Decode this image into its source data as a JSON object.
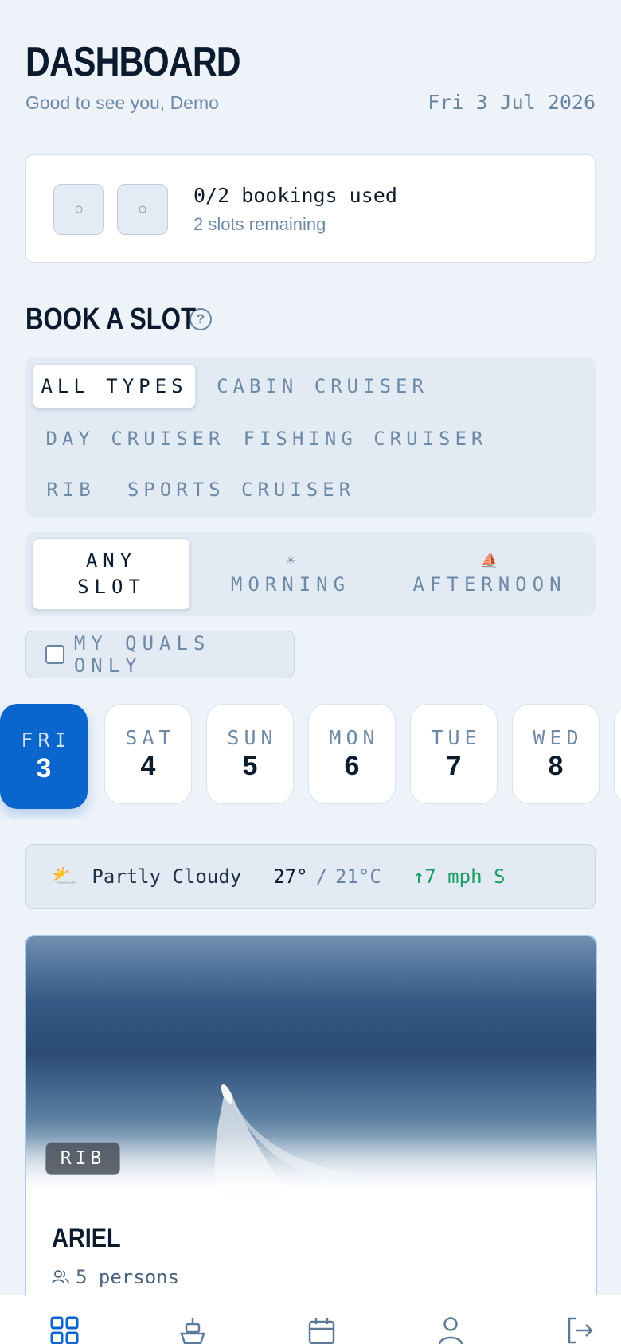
{
  "header": {
    "title": "DASHBOARD",
    "greeting": "Good to see you, Demo",
    "date": "Fri 3 Jul 2026"
  },
  "bookings": {
    "slot_marker": "○",
    "used_text": "0/2 bookings used",
    "remaining_text": "2 slots remaining"
  },
  "section": {
    "title": "BOOK A SLOT",
    "help_glyph": "?"
  },
  "boat_types": {
    "items": [
      "ALL TYPES",
      "CABIN CRUISER",
      "DAY CRUISER",
      "FISHING CRUISER",
      "RIB",
      "SPORTS CRUISER"
    ],
    "selected": "ALL TYPES"
  },
  "slots": {
    "any_line1": "ANY",
    "any_line2": "SLOT",
    "morning": "MORNING",
    "morning_icon": "☀",
    "afternoon": "AFTERNOON",
    "afternoon_icon": "⛵",
    "selected": "ANY SLOT"
  },
  "filters": {
    "quals_label": "MY QUALS ONLY",
    "quals_checked": false
  },
  "days": [
    {
      "name": "FRI",
      "num": "3",
      "selected": true
    },
    {
      "name": "SAT",
      "num": "4",
      "selected": false
    },
    {
      "name": "SUN",
      "num": "5",
      "selected": false
    },
    {
      "name": "MON",
      "num": "6",
      "selected": false
    },
    {
      "name": "TUE",
      "num": "7",
      "selected": false
    },
    {
      "name": "WED",
      "num": "8",
      "selected": false
    }
  ],
  "weather": {
    "icon": "⛅",
    "condition": "Partly Cloudy",
    "high": "27°",
    "separator": "/",
    "low": "21°C",
    "wind": "↑7 mph S"
  },
  "boat": {
    "type_badge": "RIB",
    "name": "ARIEL",
    "capacity": "5 persons"
  },
  "nav": {
    "icons": [
      "dashboard-icon",
      "boat-icon",
      "calendar-icon",
      "profile-icon",
      "logout-icon"
    ]
  },
  "colors": {
    "accent": "#0a66cc",
    "background": "#eef3f9",
    "muted_text": "#6d8aa8",
    "wind_green": "#1a9e63"
  }
}
